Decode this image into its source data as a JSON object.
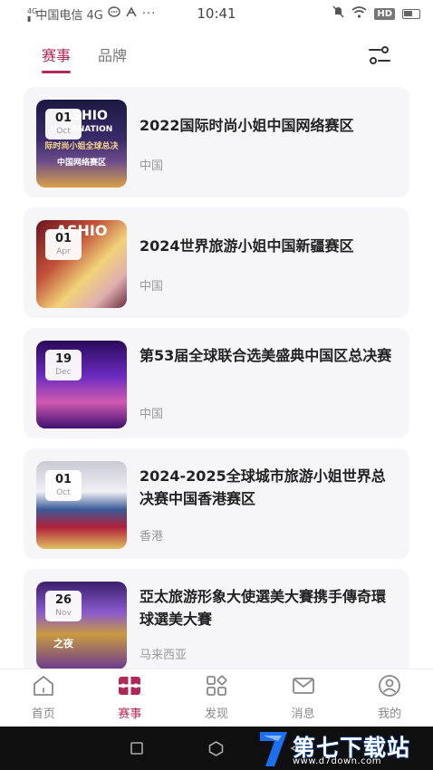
{
  "status_bar": {
    "signal_small": "4G",
    "carrier": "中国电信 4G",
    "time": "10:41",
    "hd_badge": "HD"
  },
  "tabs": [
    {
      "label": "赛事",
      "active": true
    },
    {
      "label": "品牌",
      "active": false
    }
  ],
  "events": [
    {
      "day": "01",
      "month": "Oct",
      "title": "2022国际时尚小姐中国网络赛区",
      "location": "中国",
      "thumb_text": [
        "FASHIO",
        "INTERNATION",
        "际时尚小姐全球总决",
        "中国网络赛区"
      ]
    },
    {
      "day": "01",
      "month": "Apr",
      "title": "2024世界旅游小姐中国新疆赛区",
      "location": "中国",
      "thumb_text": [
        "ASHIO"
      ]
    },
    {
      "day": "19",
      "month": "Dec",
      "title": "第53届全球联合选美盛典中国区总决赛",
      "location": "中国",
      "thumb_text": []
    },
    {
      "day": "01",
      "month": "Oct",
      "title": "2024-2025全球城市旅游小姐世界总决赛中国香港赛区",
      "location": "香港",
      "thumb_text": []
    },
    {
      "day": "26",
      "month": "Nov",
      "title": "亞太旅游形象大使選美大賽携手傳奇環球選美大賽",
      "location": "马来西亚",
      "thumb_text": [
        "之夜"
      ]
    }
  ],
  "bottom_nav": [
    {
      "label": "首页",
      "icon": "home-icon",
      "active": false
    },
    {
      "label": "赛事",
      "icon": "events-icon",
      "active": true
    },
    {
      "label": "发现",
      "icon": "discover-icon",
      "active": false
    },
    {
      "label": "消息",
      "icon": "message-icon",
      "active": false
    },
    {
      "label": "我的",
      "icon": "profile-icon",
      "active": false
    }
  ],
  "watermark": {
    "title": "第七下载站",
    "url": "www.d7down.com"
  },
  "colors": {
    "accent": "#b0275a",
    "card_bg": "#f6f6f8"
  }
}
